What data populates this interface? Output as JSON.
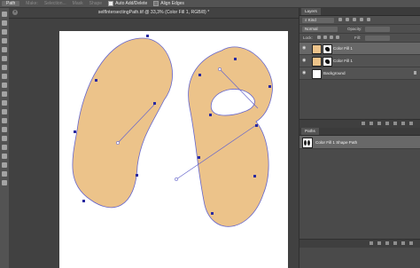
{
  "options_bar": {
    "tool_mode": "Path",
    "make_label": "Make:",
    "selection_label": "Selection...",
    "mask_label": "Mask",
    "shape_label": "Shape",
    "auto_add_delete_label": "Auto Add/Delete",
    "align_edges_label": "Align Edges"
  },
  "document": {
    "tab_title": "selfIntersectingPath.tif @ 33,3% (Color Fill 1, RGB/8) *"
  },
  "canvas": {
    "fill_color": "#ecc38a",
    "path_color": "#6666cc",
    "anchor_color": "#2a2aa0"
  },
  "layers_panel": {
    "tab_label": "Layers",
    "filter_kind": "Kind",
    "blend_mode": "Normal",
    "opacity_label": "Opacity:",
    "lock_label": "Lock:",
    "fill_label": "Fill:",
    "layers": [
      {
        "name": "Color Fill 1",
        "selected": true,
        "type": "fill"
      },
      {
        "name": "Color Fill 1",
        "selected": false,
        "type": "fill"
      },
      {
        "name": "Background",
        "selected": false,
        "type": "background"
      }
    ]
  },
  "paths_panel": {
    "tab_label": "Paths",
    "paths": [
      {
        "name": "Color Fill 1 Shape Path",
        "selected": true
      }
    ]
  }
}
